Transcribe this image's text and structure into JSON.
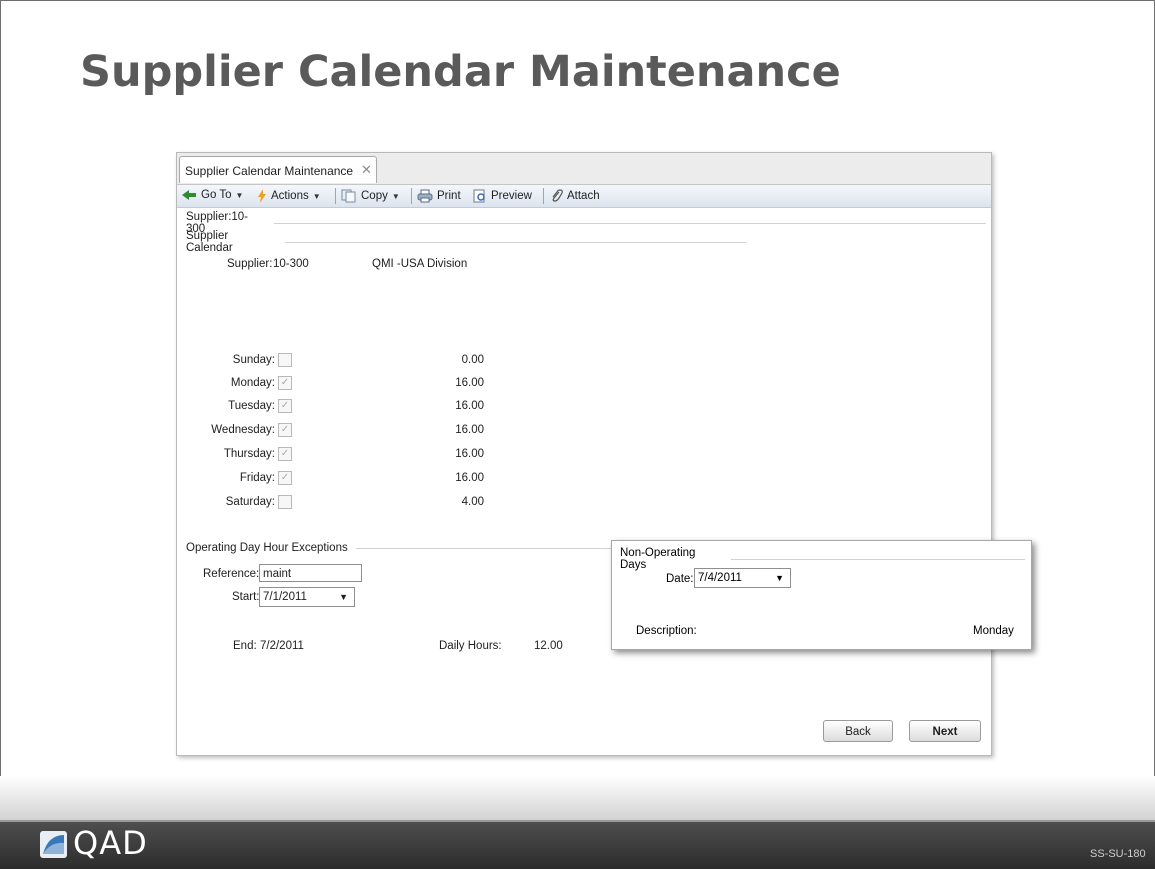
{
  "slide": {
    "title": "Supplier Calendar Maintenance",
    "logo_text": "QAD",
    "code": "SS-SU-180"
  },
  "window": {
    "tab_label": "Supplier Calendar Maintenance",
    "toolbar": {
      "goto": "Go To",
      "actions": "Actions",
      "copy": "Copy",
      "print": "Print",
      "preview": "Preview",
      "attach": "Attach"
    },
    "breadcrumb": "Supplier:10-300",
    "calendar_section": "Supplier Calendar",
    "supplier_label": "Supplier:",
    "supplier_code": "10-300",
    "supplier_name": "QMI -USA Division",
    "days": [
      {
        "label": "Sunday:",
        "checked": false,
        "hours": "0.00"
      },
      {
        "label": "Monday:",
        "checked": true,
        "hours": "16.00"
      },
      {
        "label": "Tuesday:",
        "checked": true,
        "hours": "16.00"
      },
      {
        "label": "Wednesday:",
        "checked": true,
        "hours": "16.00"
      },
      {
        "label": "Thursday:",
        "checked": true,
        "hours": "16.00"
      },
      {
        "label": "Friday:",
        "checked": true,
        "hours": "16.00"
      },
      {
        "label": "Saturday:",
        "checked": false,
        "hours": "4.00"
      }
    ],
    "exceptions_section": "Operating Day Hour Exceptions",
    "reference_label": "Reference:",
    "reference_value": "maint",
    "start_label": "Start:",
    "start_value": "7/1/2011",
    "end_label": "End:",
    "end_value": "7/2/2011",
    "daily_hours_label": "Daily Hours:",
    "daily_hours_value": "12.00",
    "back_label": "Back",
    "next_label": "Next"
  },
  "popup": {
    "title": "Non-Operating Days",
    "date_label": "Date:",
    "date_value": "7/4/2011",
    "description_label": "Description:",
    "description_value": "Monday"
  }
}
